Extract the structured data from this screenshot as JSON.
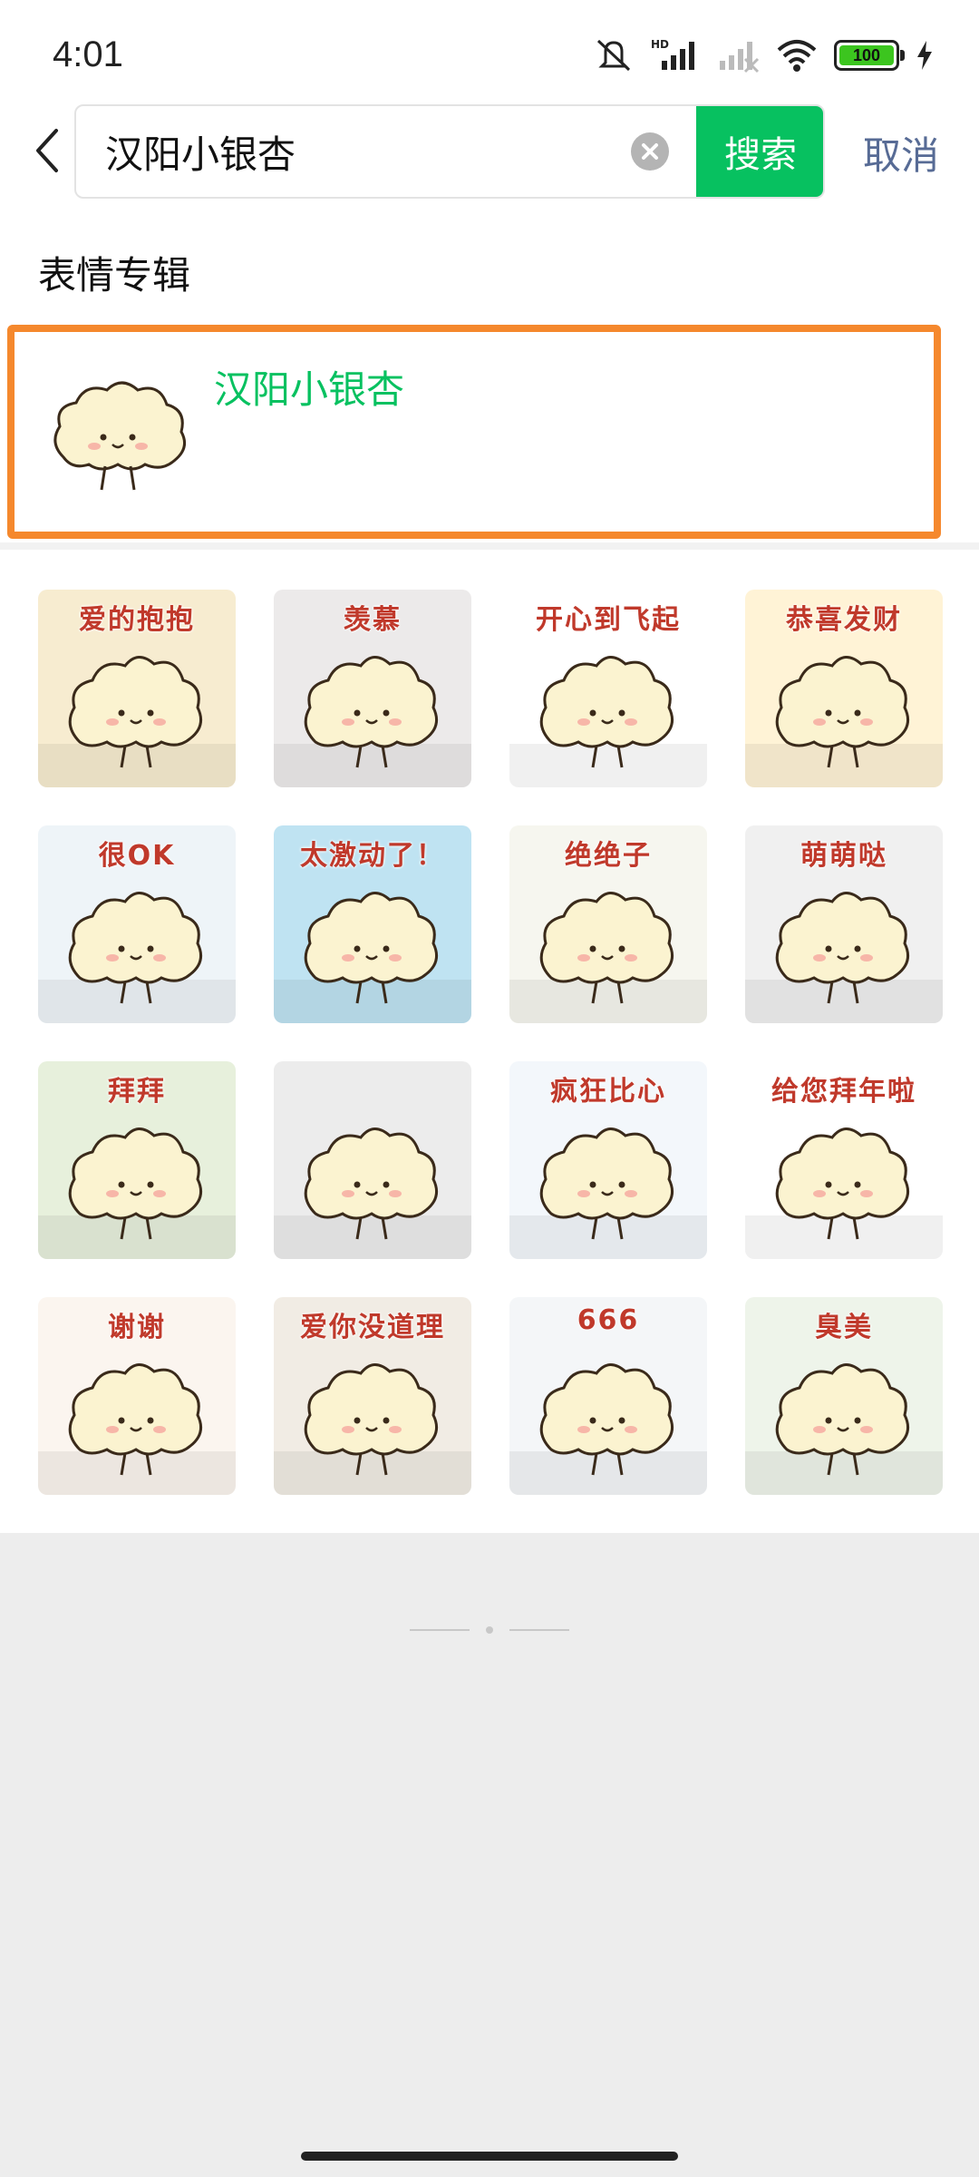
{
  "status_bar": {
    "time": "4:01",
    "battery_level": "100",
    "icons": [
      "mute-icon",
      "hd-signal-icon",
      "no-signal-icon",
      "wifi-icon",
      "battery-icon",
      "charging-icon"
    ]
  },
  "search": {
    "query": "汉阳小银杏",
    "search_label": "搜索",
    "cancel_label": "取消"
  },
  "section_title": "表情专辑",
  "album": {
    "name": "汉阳小银杏"
  },
  "stickers": [
    {
      "caption": "爱的抱抱",
      "bg": "#f7ecd0"
    },
    {
      "caption": "羡慕",
      "bg": "#eceaea"
    },
    {
      "caption": "开心到飞起",
      "bg": "#ffffff"
    },
    {
      "caption": "恭喜发财",
      "bg": "#fff3d6"
    },
    {
      "caption": "很OK",
      "bg": "#eef4f8"
    },
    {
      "caption": "太激动了！",
      "bg": "#bfe3f2"
    },
    {
      "caption": "绝绝子",
      "bg": "#f6f6ef"
    },
    {
      "caption": "萌萌哒",
      "bg": "#f0f0f0"
    },
    {
      "caption": "拜拜",
      "bg": "#e7f0dc"
    },
    {
      "caption": "",
      "bg": "#ececec"
    },
    {
      "caption": "疯狂比心",
      "bg": "#f3f7fb"
    },
    {
      "caption": "给您拜年啦",
      "bg": "#ffffff"
    },
    {
      "caption": "谢谢",
      "bg": "#fbf5ef"
    },
    {
      "caption": "爱你没道理",
      "bg": "#f1ece4"
    },
    {
      "caption": "666",
      "bg": "#f4f6f8"
    },
    {
      "caption": "臭美",
      "bg": "#eef4ea"
    }
  ],
  "colors": {
    "accent_green": "#07c160",
    "highlight_orange": "#f5882d",
    "cancel_blue": "#576b95",
    "sticker_caption_red": "#c0392b"
  }
}
